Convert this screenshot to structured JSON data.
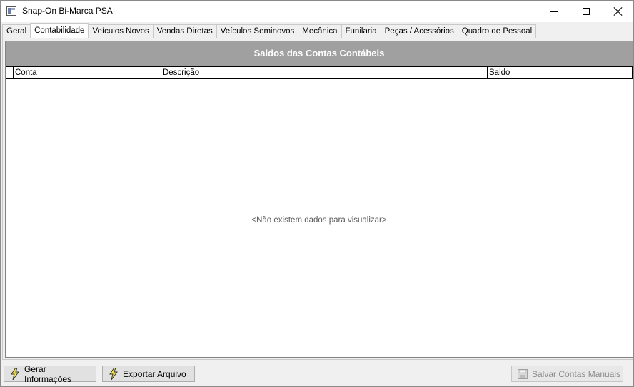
{
  "window": {
    "title": "Snap-On Bi-Marca PSA",
    "icon": "app-window-icon"
  },
  "tabs": [
    {
      "label": "Geral",
      "active": false
    },
    {
      "label": "Contabilidade",
      "active": true
    },
    {
      "label": "Veículos Novos",
      "active": false
    },
    {
      "label": "Vendas Diretas",
      "active": false
    },
    {
      "label": "Veículos Seminovos",
      "active": false
    },
    {
      "label": "Mecânica",
      "active": false
    },
    {
      "label": "Funilaria",
      "active": false
    },
    {
      "label": "Peças / Acessórios",
      "active": false
    },
    {
      "label": "Quadro de Pessoal",
      "active": false
    }
  ],
  "grid": {
    "title": "Saldos das Contas Contábeis",
    "columns": [
      "Conta",
      "Descrição",
      "Saldo"
    ],
    "empty_message": "<Não existem dados para visualizar>",
    "title_bg": "#a0a0a0"
  },
  "buttons": {
    "gerar": {
      "label_underlined": "G",
      "label_rest": "erar Informações",
      "icon": "lightning-bolt-icon"
    },
    "exportar": {
      "label_underlined": "E",
      "label_rest": "xportar Arquivo",
      "icon": "lightning-bolt-icon"
    },
    "salvar": {
      "label": "Salvar Contas Manuais",
      "icon": "floppy-disk-icon",
      "enabled": false
    }
  }
}
